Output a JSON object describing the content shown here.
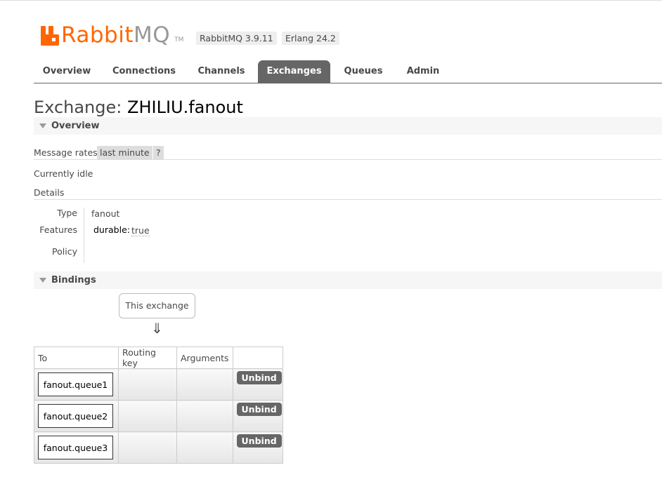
{
  "header": {
    "logo_rabbit": "Rabbit",
    "logo_mq": "MQ",
    "logo_tm": "TM",
    "version_rabbitmq": "RabbitMQ 3.9.11",
    "version_erlang": "Erlang 24.2"
  },
  "nav": {
    "tabs": [
      {
        "label": "Overview"
      },
      {
        "label": "Connections"
      },
      {
        "label": "Channels"
      },
      {
        "label": "Exchanges",
        "active": true
      },
      {
        "label": "Queues"
      },
      {
        "label": "Admin"
      }
    ]
  },
  "page": {
    "title_prefix": "Exchange:",
    "exchange_name": "ZHILIU.fanout"
  },
  "overview": {
    "section_label": "Overview",
    "message_rates_label": "Message rates",
    "message_rates_period": "last minute",
    "help_label": "?",
    "idle_text": "Currently idle",
    "details_label": "Details",
    "details": {
      "type_label": "Type",
      "type_value": "fanout",
      "features_label": "Features",
      "feature_key": "durable:",
      "feature_value": "true",
      "policy_label": "Policy"
    }
  },
  "bindings": {
    "section_label": "Bindings",
    "this_exchange_label": "This exchange",
    "arrow_glyph": "⇓",
    "columns": [
      "To",
      "Routing key",
      "Arguments",
      ""
    ],
    "rows": [
      {
        "to": "fanout.queue1",
        "routing_key": "",
        "arguments": "",
        "action": "Unbind"
      },
      {
        "to": "fanout.queue2",
        "routing_key": "",
        "arguments": "",
        "action": "Unbind"
      },
      {
        "to": "fanout.queue3",
        "routing_key": "",
        "arguments": "",
        "action": "Unbind"
      }
    ]
  },
  "colors": {
    "brand": "#ff6600",
    "nav_active_bg": "#666666",
    "button_bg": "#666666"
  }
}
